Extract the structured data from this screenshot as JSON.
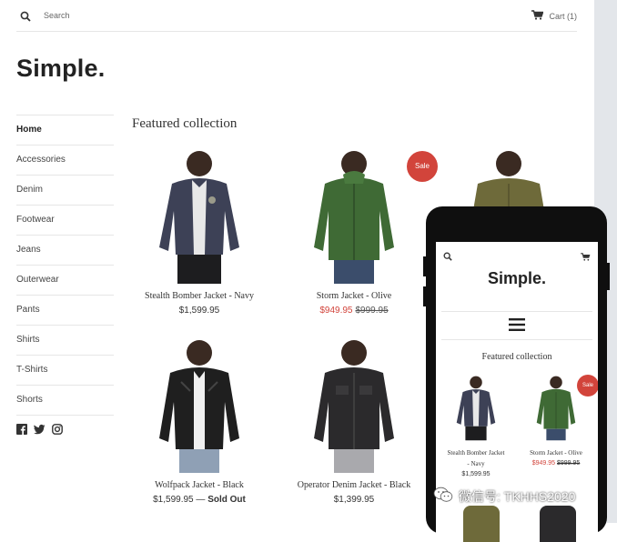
{
  "header": {
    "search_label": "Search",
    "cart_label": "Cart (1)"
  },
  "brand": {
    "logo": "Simple."
  },
  "sidebar": {
    "items": [
      {
        "label": "Home"
      },
      {
        "label": "Accessories"
      },
      {
        "label": "Denim"
      },
      {
        "label": "Footwear"
      },
      {
        "label": "Jeans"
      },
      {
        "label": "Outerwear"
      },
      {
        "label": "Pants"
      },
      {
        "label": "Shirts"
      },
      {
        "label": "T-Shirts"
      },
      {
        "label": "Shorts"
      }
    ],
    "social_icons": [
      "facebook-icon",
      "twitter-icon",
      "instagram-icon"
    ]
  },
  "main": {
    "section_title": "Featured collection",
    "products": [
      {
        "name": "Stealth Bomber Jacket - Navy",
        "price": "$1,599.95",
        "jacket_color": "#3d4156"
      },
      {
        "name": "Storm Jacket - Olive",
        "sale_price": "$949.95",
        "compare_price": "$999.95",
        "badge": "Sale",
        "jacket_color": "#3f6a35"
      },
      {
        "name": "",
        "price": "",
        "jacket_color": "#6e6a3a"
      },
      {
        "name": "Wolfpack Jacket - Black",
        "price": "$1,599.95",
        "separator": " — ",
        "status": "Sold Out",
        "jacket_color": "#1f1f1f"
      },
      {
        "name": "Operator Denim Jacket - Black",
        "price": "$1,399.95",
        "jacket_color": "#2b2a2c"
      }
    ]
  },
  "mobile": {
    "logo": "Simple.",
    "section_title": "Featured collection",
    "products": [
      {
        "name_line1": "Stealth Bomber Jacket",
        "name_line2": "- Navy",
        "price": "$1,599.95"
      },
      {
        "name_line1": "Storm Jacket - Olive",
        "sale_price": "$949.95",
        "compare_price": "$999.95",
        "badge": "Sale"
      }
    ]
  },
  "watermark": {
    "text": "微信号: TKHHS2020"
  },
  "colors": {
    "sale": "#d2443b",
    "divider": "#e6e6e6",
    "phone": "#0f0f0f"
  }
}
